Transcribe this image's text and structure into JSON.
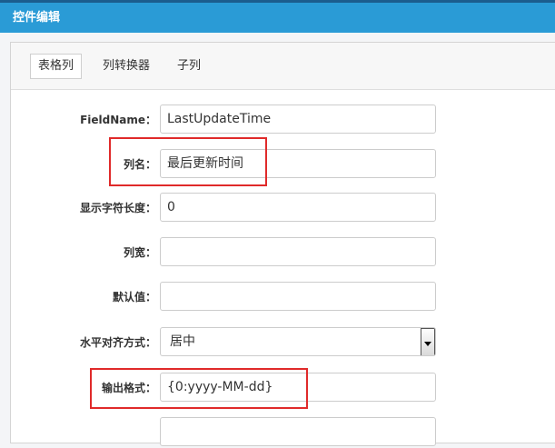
{
  "window": {
    "title": "控件编辑"
  },
  "tabs": [
    {
      "label": "表格列",
      "active": true
    },
    {
      "label": "列转换器",
      "active": false
    },
    {
      "label": "子列",
      "active": false
    }
  ],
  "form": {
    "field_name": {
      "label": "FieldName：",
      "value": "LastUpdateTime"
    },
    "column_name": {
      "label": "列名：",
      "value": "最后更新时间"
    },
    "display_length": {
      "label": "显示字符长度：",
      "value": "0"
    },
    "column_width": {
      "label": "列宽：",
      "value": ""
    },
    "default_value": {
      "label": "默认值：",
      "value": ""
    },
    "h_align": {
      "label": "水平对齐方式：",
      "value": "居中"
    },
    "output_format": {
      "label": "输出格式：",
      "value": "{0:yyyy-MM-dd}"
    },
    "next_field": {
      "label": "",
      "value": ""
    }
  },
  "colors": {
    "title_bar": "#2a9bd6",
    "highlight": "#e02a2a"
  }
}
